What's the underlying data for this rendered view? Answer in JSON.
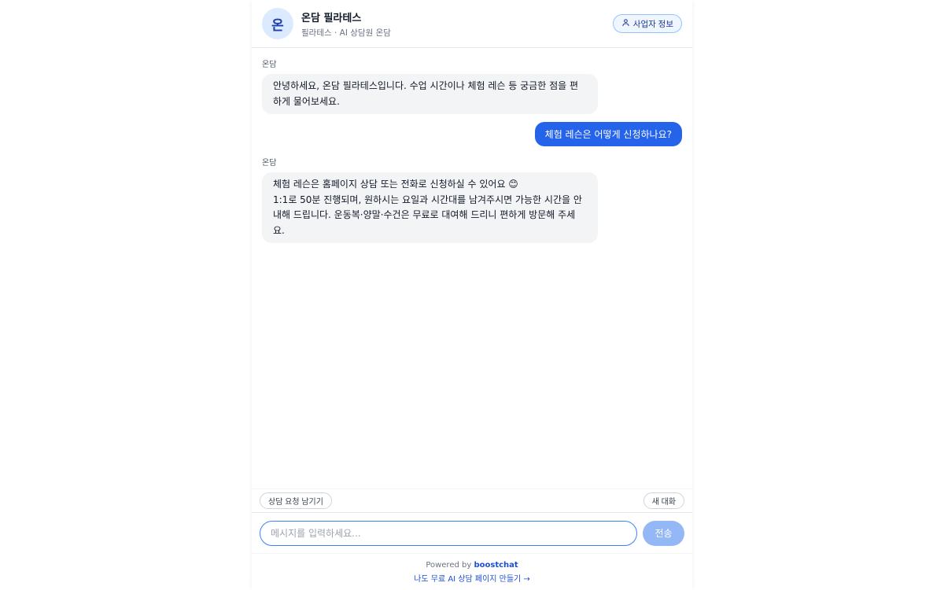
{
  "header": {
    "avatar_text": "온",
    "name": "온담 필라테스",
    "subtitle": "필라테스 · AI 상담원 온담",
    "business_info_label": "사업자 정보"
  },
  "messages": [
    {
      "role": "bot",
      "sender": "온담",
      "text": "안녕하세요, 온담 필라테스입니다. 수업 시간이나 체험 레슨 등 궁금한 점을 편하게 물어보세요."
    },
    {
      "role": "user",
      "text": "체험 레슨은 어떻게 신청하나요?"
    },
    {
      "role": "bot",
      "sender": "온담",
      "text": "체험 레슨은 홈페이지 상담 또는 전화로 신청하실 수 있어요 😊\n1:1로 50분 진행되며, 원하시는 요일과 시간대를 남겨주시면 가능한 시간을 안내해 드립니다. 운동복·양말·수건은 무료로 대여해 드리니 편하게 방문해 주세요."
    }
  ],
  "actions": {
    "leave_request_label": "상담 요청 남기기",
    "new_chat_label": "새 대화"
  },
  "composer": {
    "placeholder": "메시지를 입력하세요...",
    "send_label": "전송"
  },
  "footer": {
    "powered_prefix": "Powered by",
    "brand": "boostchat",
    "make_link": "나도 무료 AI 상담 페이지 만들기 →"
  }
}
